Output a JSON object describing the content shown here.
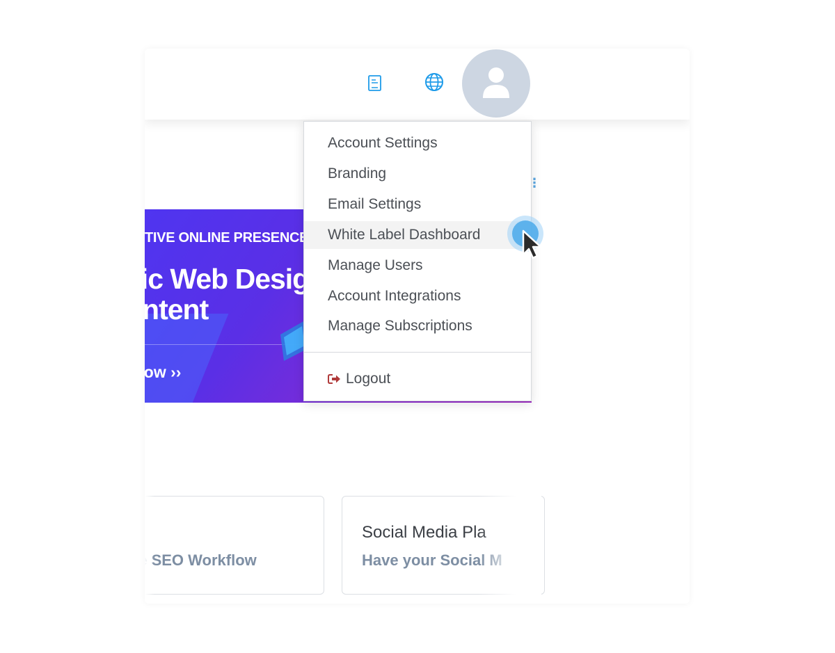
{
  "header": {
    "icons": [
      "document-icon",
      "globe-icon",
      "user-avatar-icon"
    ]
  },
  "banner": {
    "kicker": "TIVE ONLINE PRESENCE",
    "headline_line1": "sic Web Desig",
    "headline_line2": "ontent",
    "cta": "llow ››"
  },
  "tiles": [
    {
      "title": "",
      "subtitle": "ve SEO Workflow"
    },
    {
      "title": "Social Media Pla",
      "subtitle": "Have your Social M"
    }
  ],
  "menu": {
    "items": [
      "Account Settings",
      "Branding",
      "Email Settings",
      "White Label Dashboard",
      "Manage Users",
      "Account Integrations",
      "Manage Subscriptions"
    ],
    "active_index": 3,
    "logout_label": "Logout"
  },
  "colors": {
    "accent": "#1e9be9",
    "avatar_bg": "#cdd6e2",
    "logout_icon": "#b03a3a"
  }
}
